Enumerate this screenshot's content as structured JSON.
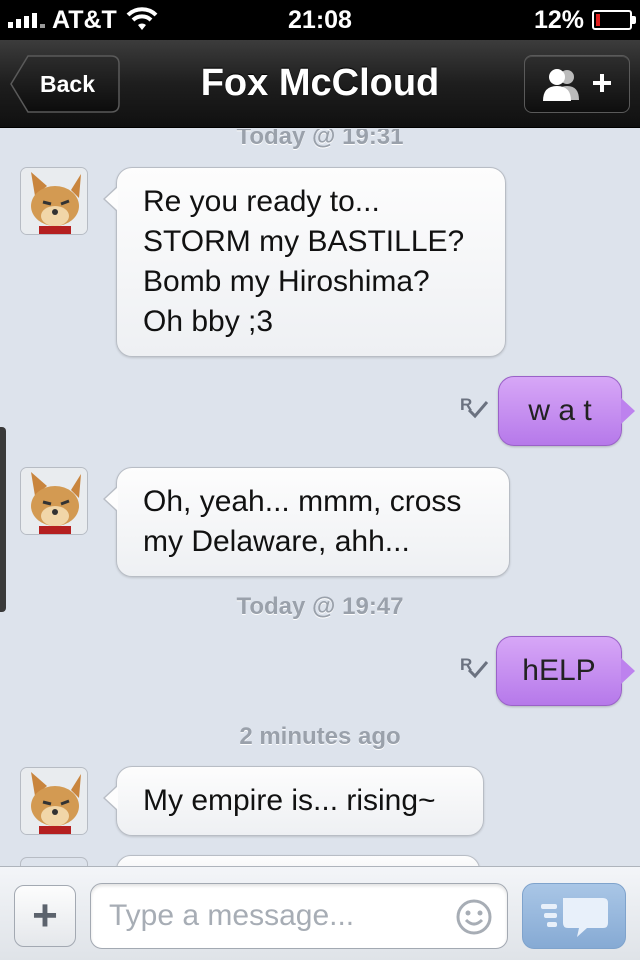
{
  "status_bar": {
    "carrier": "AT&T",
    "time": "21:08",
    "battery_percent_label": "12%",
    "battery_level": 0.12,
    "battery_color": "#e02020",
    "icons": [
      "signal-bars-icon",
      "wifi-icon",
      "battery-icon"
    ]
  },
  "nav": {
    "back_label": "Back",
    "title": "Fox McCloud",
    "right_button_icon": "add-contact-icon"
  },
  "conversation": {
    "timestamps": [
      "Today @ 19:31",
      "Today @ 19:47",
      "2 minutes ago"
    ],
    "messages": [
      {
        "direction": "in",
        "lines": [
          "Re you ready to...",
          "STORM my BASTILLE?",
          "Bomb my Hiroshima?",
          "Oh bby ;3"
        ]
      },
      {
        "direction": "out",
        "text": "w a t",
        "read_mark": "R"
      },
      {
        "direction": "in",
        "lines": [
          "Oh, yeah... mmm, cross",
          "my Delaware, ahh..."
        ]
      },
      {
        "direction": "out",
        "text": "hELP",
        "read_mark": "R"
      },
      {
        "direction": "in",
        "lines": [
          "My empire is... rising~"
        ]
      }
    ]
  },
  "input_bar": {
    "attach_label": "+",
    "placeholder": "Type a message...",
    "emoji_icon": "smiley-icon",
    "send_icon": "send-bubble-icon"
  },
  "colors": {
    "outgoing_bubble": "#c08ef0",
    "incoming_bubble": "#f7f8fa",
    "chat_background": "#dde3ec",
    "send_button": "#98b8dd"
  }
}
